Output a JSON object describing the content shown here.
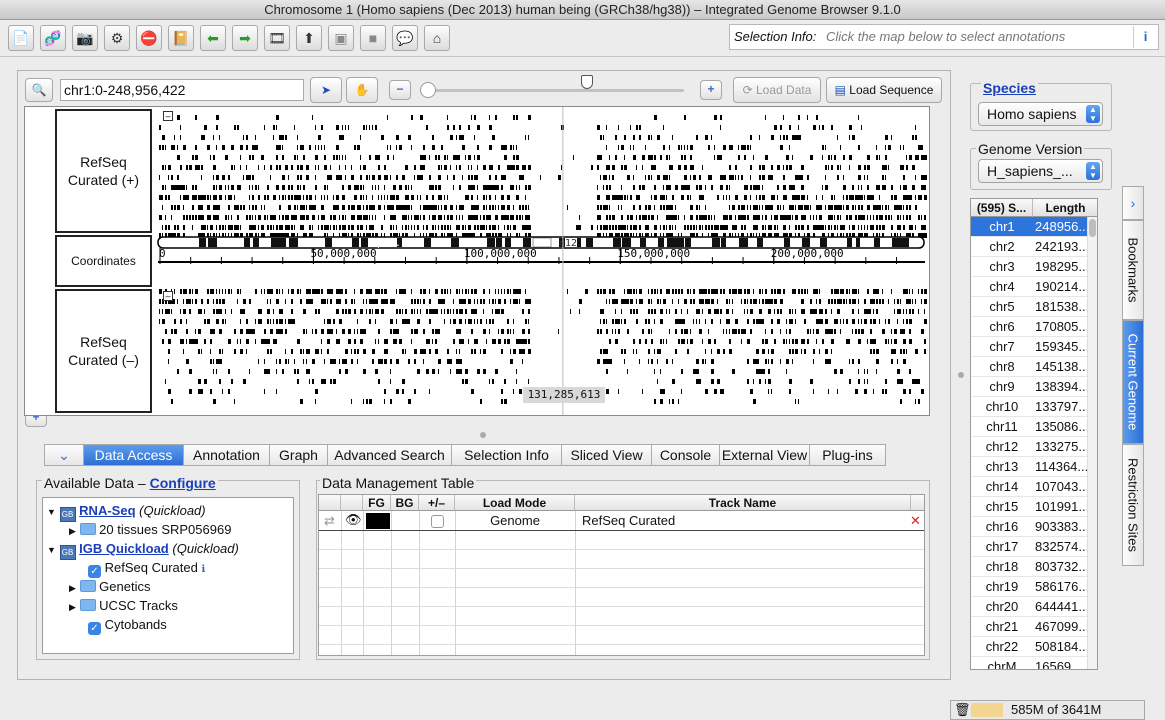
{
  "window": {
    "title": "Chromosome 1  (Homo sapiens (Dec 2013) human being (GRCh38/hg38)) – Integrated Genome Browser 9.1.0"
  },
  "toolbar": {
    "icons": [
      "open-file-icon",
      "dna-icon",
      "camera-icon",
      "gear-icon",
      "stop-icon",
      "book-icon",
      "back-arrow-icon",
      "forward-arrow-icon",
      "film-icon",
      "upload-icon",
      "panel-icon",
      "panel-icon-2",
      "speech-bubble-icon",
      "home-icon"
    ],
    "selection_info_label": "Selection Info:",
    "selection_info_placeholder": "Click the map below to select annotations",
    "info_button": "i"
  },
  "nav": {
    "location": "chr1:0-248,956,422",
    "load_data": "Load Data",
    "load_sequence": "Load Sequence",
    "zoom_position": 0.0
  },
  "tracks": {
    "plus_label": "RefSeq Curated (+)",
    "coord_label": "Coordinates",
    "minus_label": "RefSeq Curated (–)",
    "ticks": [
      "0",
      "50,000,000",
      "100,000,000",
      "150,000,000",
      "200,000,000"
    ],
    "bands": [
      "p31.1",
      "q12"
    ],
    "position_readout": "131,285,613",
    "collapse_glyph": "–"
  },
  "tabs": [
    "Data Access",
    "Annotation",
    "Graph",
    "Advanced Search",
    "Selection Info",
    "Sliced View",
    "Console",
    "External View",
    "Plug-ins"
  ],
  "available_data": {
    "title": "Available Data",
    "configure": "Configure",
    "items": [
      {
        "name": "RNA-Seq",
        "suffix": "(Quickload)"
      },
      {
        "name": "20 tissues SRP056969"
      },
      {
        "name": "IGB Quickload",
        "suffix": "(Quickload)"
      },
      {
        "name": "RefSeq Curated"
      },
      {
        "name": "Genetics"
      },
      {
        "name": "UCSC Tracks"
      },
      {
        "name": "Cytobands"
      }
    ]
  },
  "data_management": {
    "title": "Data Management Table",
    "columns": [
      "FG",
      "BG",
      "+/–",
      "Load Mode",
      "Track Name"
    ],
    "rows": [
      {
        "load_mode": "Genome",
        "track_name": "RefSeq Curated"
      }
    ]
  },
  "species": {
    "label": "Species",
    "value": "Homo sapiens"
  },
  "genome_version": {
    "label": "Genome Version",
    "value": "H_sapiens_..."
  },
  "chromosomes": {
    "header_name": "(595) S...",
    "header_length": "Length",
    "rows": [
      {
        "name": "chr1",
        "length": "248956..."
      },
      {
        "name": "chr2",
        "length": "242193..."
      },
      {
        "name": "chr3",
        "length": "198295..."
      },
      {
        "name": "chr4",
        "length": "190214..."
      },
      {
        "name": "chr5",
        "length": "181538..."
      },
      {
        "name": "chr6",
        "length": "170805..."
      },
      {
        "name": "chr7",
        "length": "159345..."
      },
      {
        "name": "chr8",
        "length": "145138..."
      },
      {
        "name": "chr9",
        "length": "138394..."
      },
      {
        "name": "chr10",
        "length": "133797..."
      },
      {
        "name": "chr11",
        "length": "135086..."
      },
      {
        "name": "chr12",
        "length": "133275..."
      },
      {
        "name": "chr13",
        "length": "114364..."
      },
      {
        "name": "chr14",
        "length": "107043..."
      },
      {
        "name": "chr15",
        "length": "101991..."
      },
      {
        "name": "chr16",
        "length": "903383..."
      },
      {
        "name": "chr17",
        "length": "832574..."
      },
      {
        "name": "chr18",
        "length": "803732..."
      },
      {
        "name": "chr19",
        "length": "586176..."
      },
      {
        "name": "chr20",
        "length": "644441..."
      },
      {
        "name": "chr21",
        "length": "467099..."
      },
      {
        "name": "chr22",
        "length": "508184..."
      },
      {
        "name": "chrM",
        "length": "16569"
      }
    ]
  },
  "side_tabs": [
    "Bookmarks",
    "Current Genome",
    "Restriction Sites"
  ],
  "memory": {
    "text": "585M of 3641M"
  },
  "colors": {
    "accent": "#2b6fd6",
    "selected_row": "#2d74dc",
    "remove_x": "#d22222"
  }
}
